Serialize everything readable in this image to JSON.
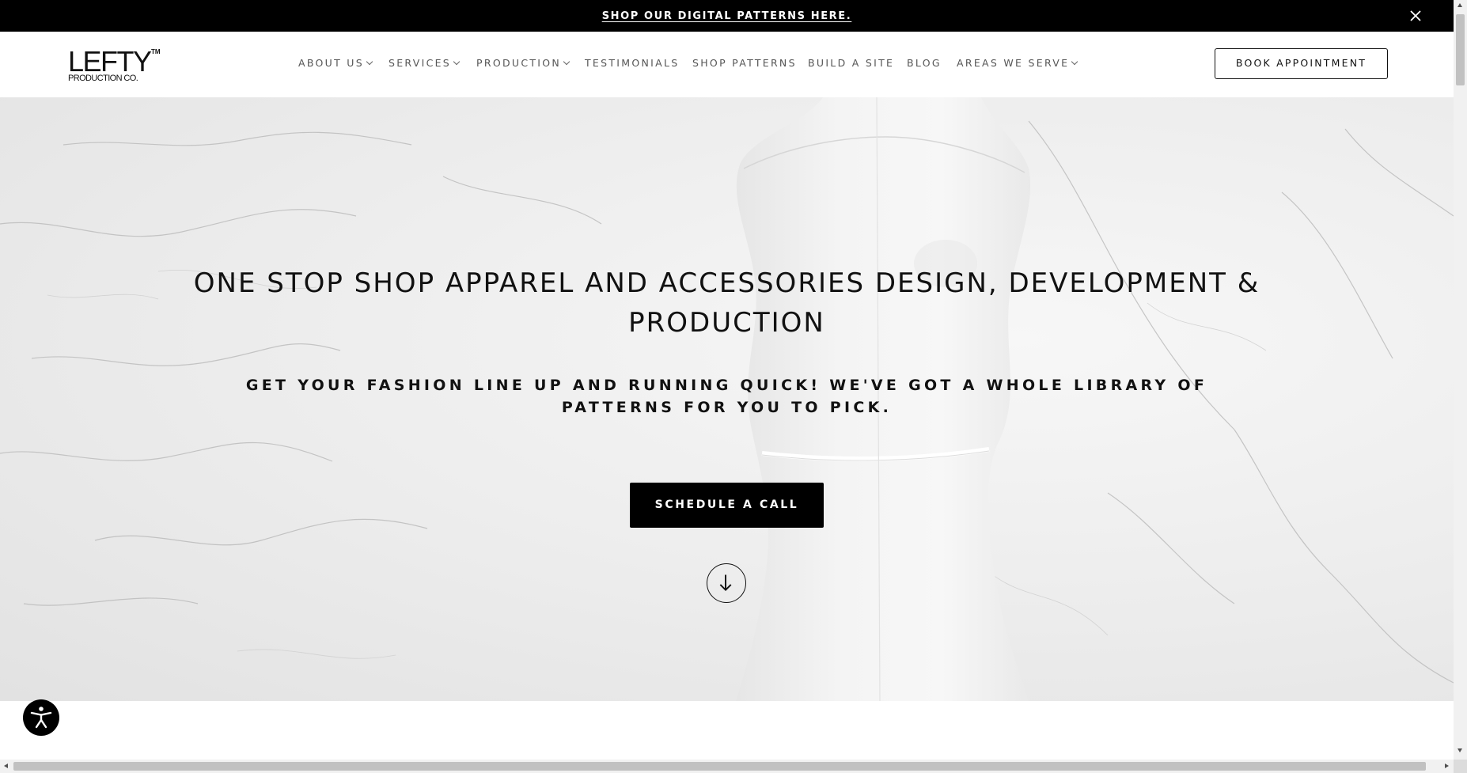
{
  "announcement": {
    "link_text": "SHOP OUR DIGITAL PATTERNS HERE."
  },
  "header": {
    "logo": {
      "main": "LEFTY",
      "trademark": "TM",
      "sub": "PRODUCTION CO."
    },
    "nav": {
      "about": "ABOUT US",
      "services": "SERVICES",
      "production": "PRODUCTION",
      "testimonials": "TESTIMONIALS",
      "shop_patterns": "SHOP PATTERNS",
      "build_site": "BUILD A SITE",
      "blog": "BLOG",
      "areas": "AREAS WE SERVE"
    },
    "book_button": "BOOK APPOINTMENT"
  },
  "hero": {
    "title": "ONE STOP SHOP APPAREL AND ACCESSORIES DESIGN, DEVELOPMENT & PRODUCTION",
    "subtitle": "GET YOUR FASHION LINE UP AND RUNNING QUICK! WE'VE GOT A WHOLE LIBRARY OF PATTERNS FOR YOU TO PICK.",
    "cta": "SCHEDULE A CALL"
  },
  "icons": {
    "close": "close-icon",
    "chevron": "chevron-down-icon",
    "scroll": "arrow-down-icon",
    "accessibility": "accessibility-icon"
  },
  "colors": {
    "announcement_bg": "#000000",
    "cta_bg": "#000000",
    "nav_text": "#555555",
    "hero_bg": "#ececec"
  }
}
